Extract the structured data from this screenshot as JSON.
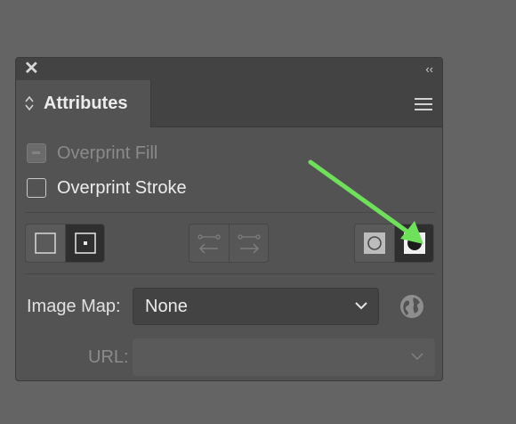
{
  "panel": {
    "tab_label": "Attributes",
    "close_icon": "close-icon",
    "collapse_icon": "collapse-icon",
    "collapse_glyph": "‹‹",
    "close_glyph": "✕",
    "menu_icon": "hamburger-menu-icon"
  },
  "overprint": {
    "fill_label": "Overprint Fill",
    "fill_checked": false,
    "fill_disabled": true,
    "stroke_label": "Overprint Stroke",
    "stroke_checked": false
  },
  "center_buttons": {
    "left_group": [
      "hide-center-point",
      "show-center-point"
    ],
    "middle_group": [
      "reverse-path-direction-off",
      "reverse-path-direction-on"
    ],
    "right_group": [
      "use-non-zero-winding-fill-rule",
      "use-even-odd-fill-rule"
    ]
  },
  "image_map": {
    "label": "Image Map:",
    "value": "None"
  },
  "url": {
    "label": "URL:",
    "value": ""
  },
  "colors": {
    "panel_bg": "#535353",
    "titlebar_bg": "#434343",
    "annotation_arrow": "#6ee05a",
    "active_button": "#2f2f2f"
  }
}
